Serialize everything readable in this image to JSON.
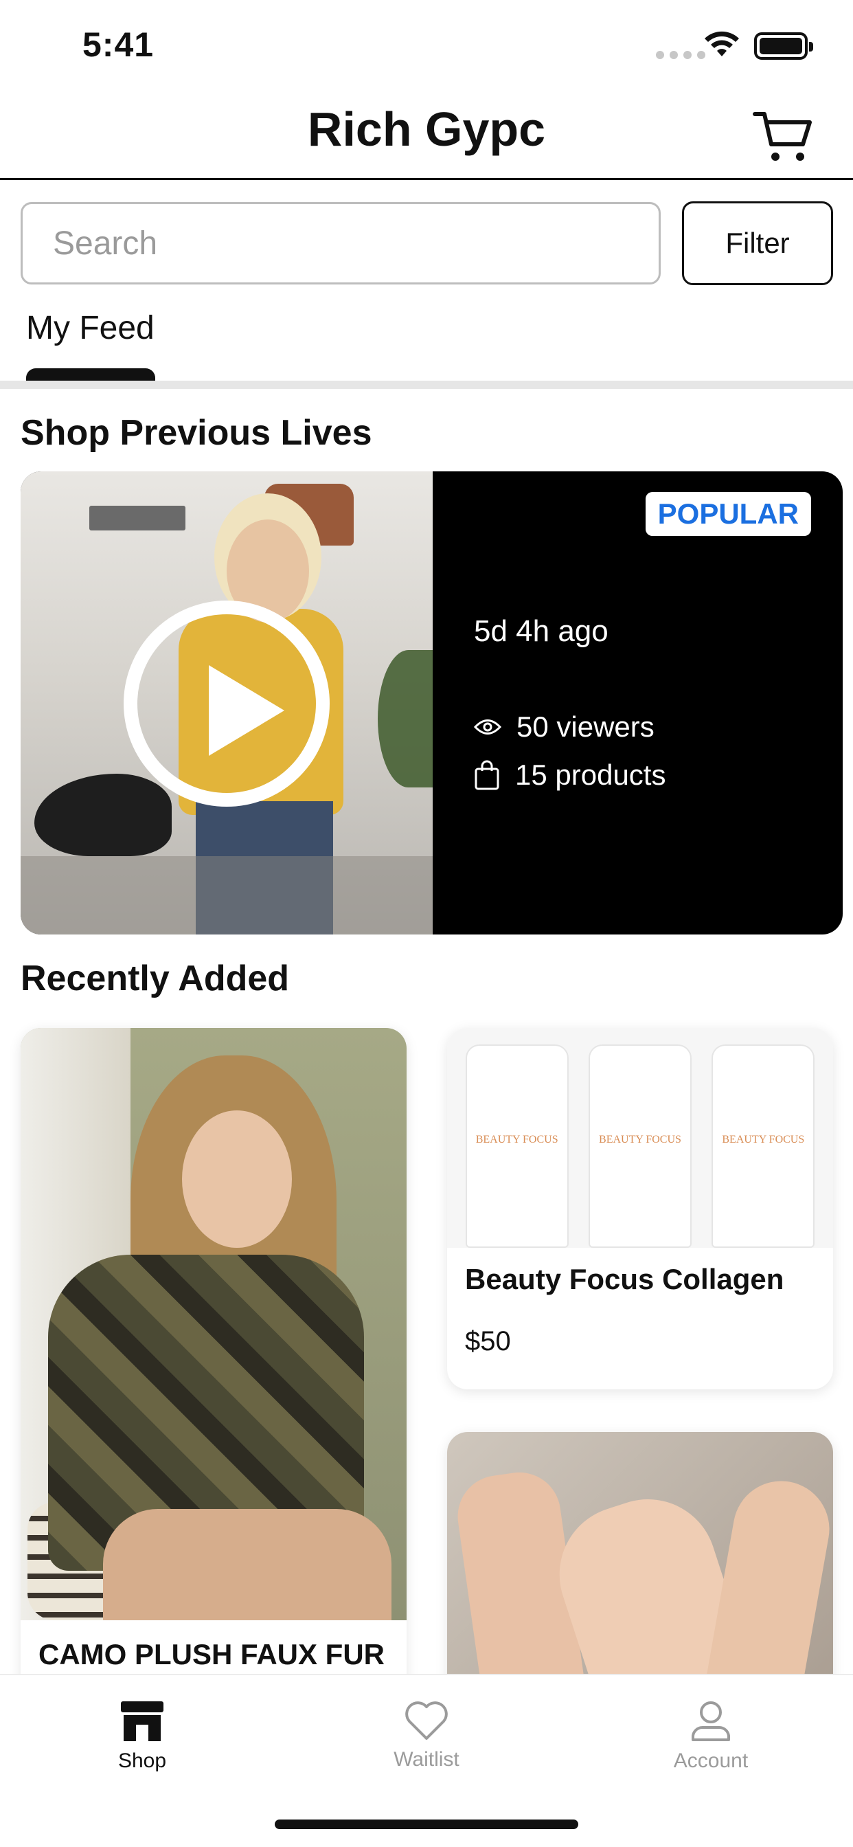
{
  "status_bar": {
    "time": "5:41"
  },
  "header": {
    "title": "Rich Gypc",
    "cart_icon": "cart-icon"
  },
  "search": {
    "placeholder": "Search",
    "value": "",
    "filter_label": "Filter"
  },
  "tabs": [
    {
      "label": "My Feed",
      "active": true
    }
  ],
  "previous_lives": {
    "title": "Shop Previous Lives",
    "card": {
      "badge": "POPULAR",
      "time_ago": "5d 4h ago",
      "viewers": "50 viewers",
      "products": "15 products",
      "badge_color": "#1b6fe0"
    }
  },
  "recently_added": {
    "title": "Recently Added",
    "items": [
      {
        "title": "CAMO PLUSH FAUX FUR"
      },
      {
        "title": "Beauty Focus Collagen",
        "price": "$50",
        "label": "BEAUTY FOCUS"
      },
      {
        "title": ""
      }
    ]
  },
  "bottom_nav": [
    {
      "label": "Shop",
      "icon": "store-icon",
      "active": true
    },
    {
      "label": "Waitlist",
      "icon": "heart-icon",
      "active": false
    },
    {
      "label": "Account",
      "icon": "user-icon",
      "active": false
    }
  ]
}
